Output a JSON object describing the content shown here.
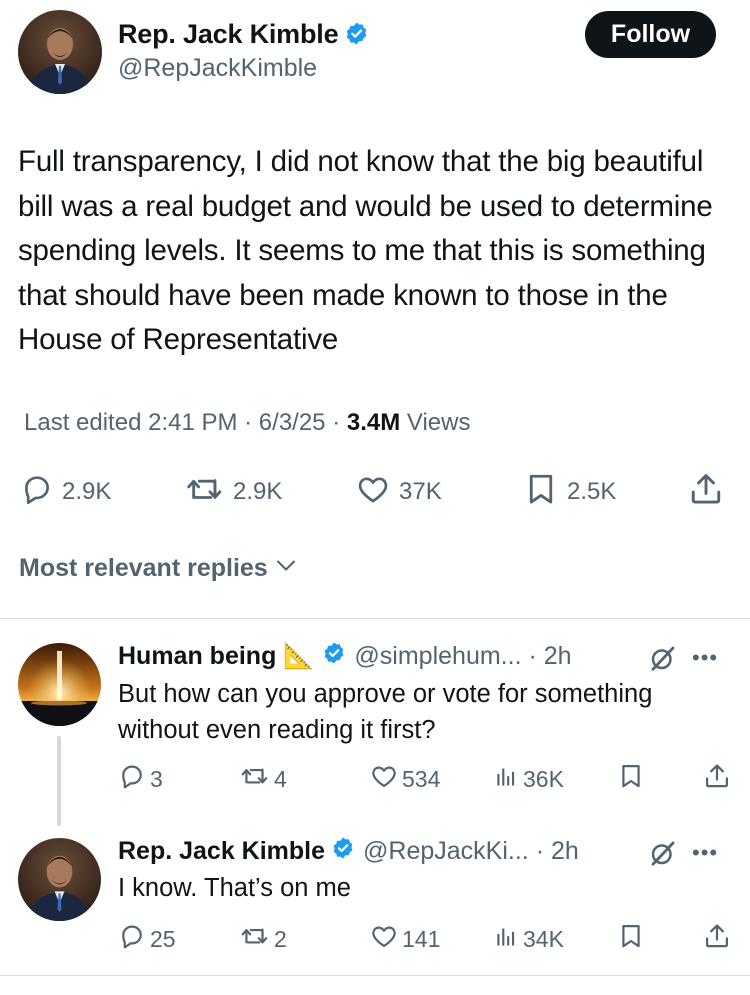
{
  "tweet": {
    "author_name": "Rep. Jack Kimble",
    "author_handle": "@RepJackKimble",
    "follow_label": "Follow",
    "text": "Full transparency, I did not know that the big beautiful bill was a real budget and would be used to determine spending levels. It seems to me that this is something that should have been made known to those in the House of Representative",
    "edited_label": "Last edited 2:41 PM · 6/3/25 · ",
    "views_count": "3.4M",
    "views_label": " Views",
    "stats": {
      "replies": "2.9K",
      "reposts": "2.9K",
      "likes": "37K",
      "bookmarks": "2.5K"
    }
  },
  "sort_label": "Most relevant replies",
  "replies": [
    {
      "name": "Human being 📐",
      "handle": "@simplehum... · 2h",
      "text": "But how can you approve or vote for something without even reading it first?",
      "replies": "3",
      "reposts": "4",
      "likes": "534",
      "views": "36K"
    },
    {
      "name": "Rep. Jack Kimble",
      "handle": "@RepJackKi... · 2h",
      "text": "I know. That’s on me",
      "replies": "25",
      "reposts": "2",
      "likes": "141",
      "views": "34K"
    }
  ],
  "colors": {
    "verified": "#1d9bf0",
    "secondary_text": "#536471",
    "primary_text": "#0f1419"
  },
  "icons": [
    "verified-badge-icon",
    "reply-icon",
    "repost-icon",
    "like-icon",
    "bookmark-icon",
    "share-icon",
    "views-icon",
    "grok-icon",
    "more-icon",
    "chevron-down-icon"
  ]
}
